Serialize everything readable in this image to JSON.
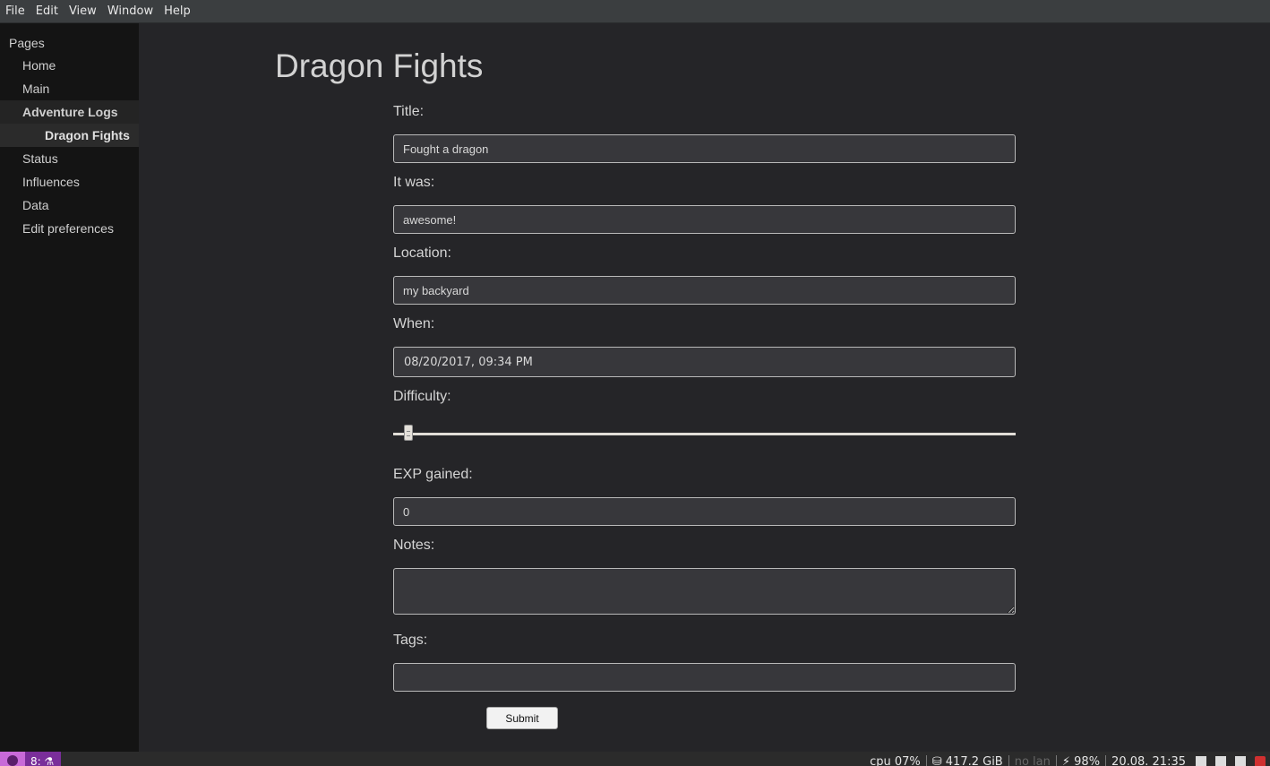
{
  "menubar": {
    "items": [
      "File",
      "Edit",
      "View",
      "Window",
      "Help"
    ]
  },
  "sidebar": {
    "heading": "Pages",
    "items": [
      {
        "label": "Home"
      },
      {
        "label": "Main"
      },
      {
        "label": "Adventure Logs"
      },
      {
        "label": "Dragon Fights"
      },
      {
        "label": "Status"
      },
      {
        "label": "Influences"
      },
      {
        "label": "Data"
      },
      {
        "label": "Edit preferences"
      }
    ]
  },
  "page": {
    "title": "Dragon Fights"
  },
  "form": {
    "title_label": "Title:",
    "title_value": "Fought a dragon",
    "itwas_label": "It was:",
    "itwas_value": "awesome!",
    "location_label": "Location:",
    "location_value": "my backyard",
    "when_label": "When:",
    "when_value": "08/20/2017, 09:34 PM",
    "difficulty_label": "Difficulty:",
    "difficulty_value": 0.024,
    "exp_label": "EXP gained:",
    "exp_value": "0",
    "notes_label": "Notes:",
    "notes_value": "",
    "tags_label": "Tags:",
    "tags_value": "",
    "submit_label": "Submit"
  },
  "taskbar": {
    "workspace": "8: ⚗",
    "cpu": "cpu  07%",
    "disk": "⛁ 417.2 GiB",
    "lan": "no lan",
    "battery": "⚡ 98%",
    "datetime": "20.08. 21:35",
    "icons": [
      "volume-icon",
      "signal-icon",
      "clipboard-icon",
      "bug-icon"
    ]
  }
}
